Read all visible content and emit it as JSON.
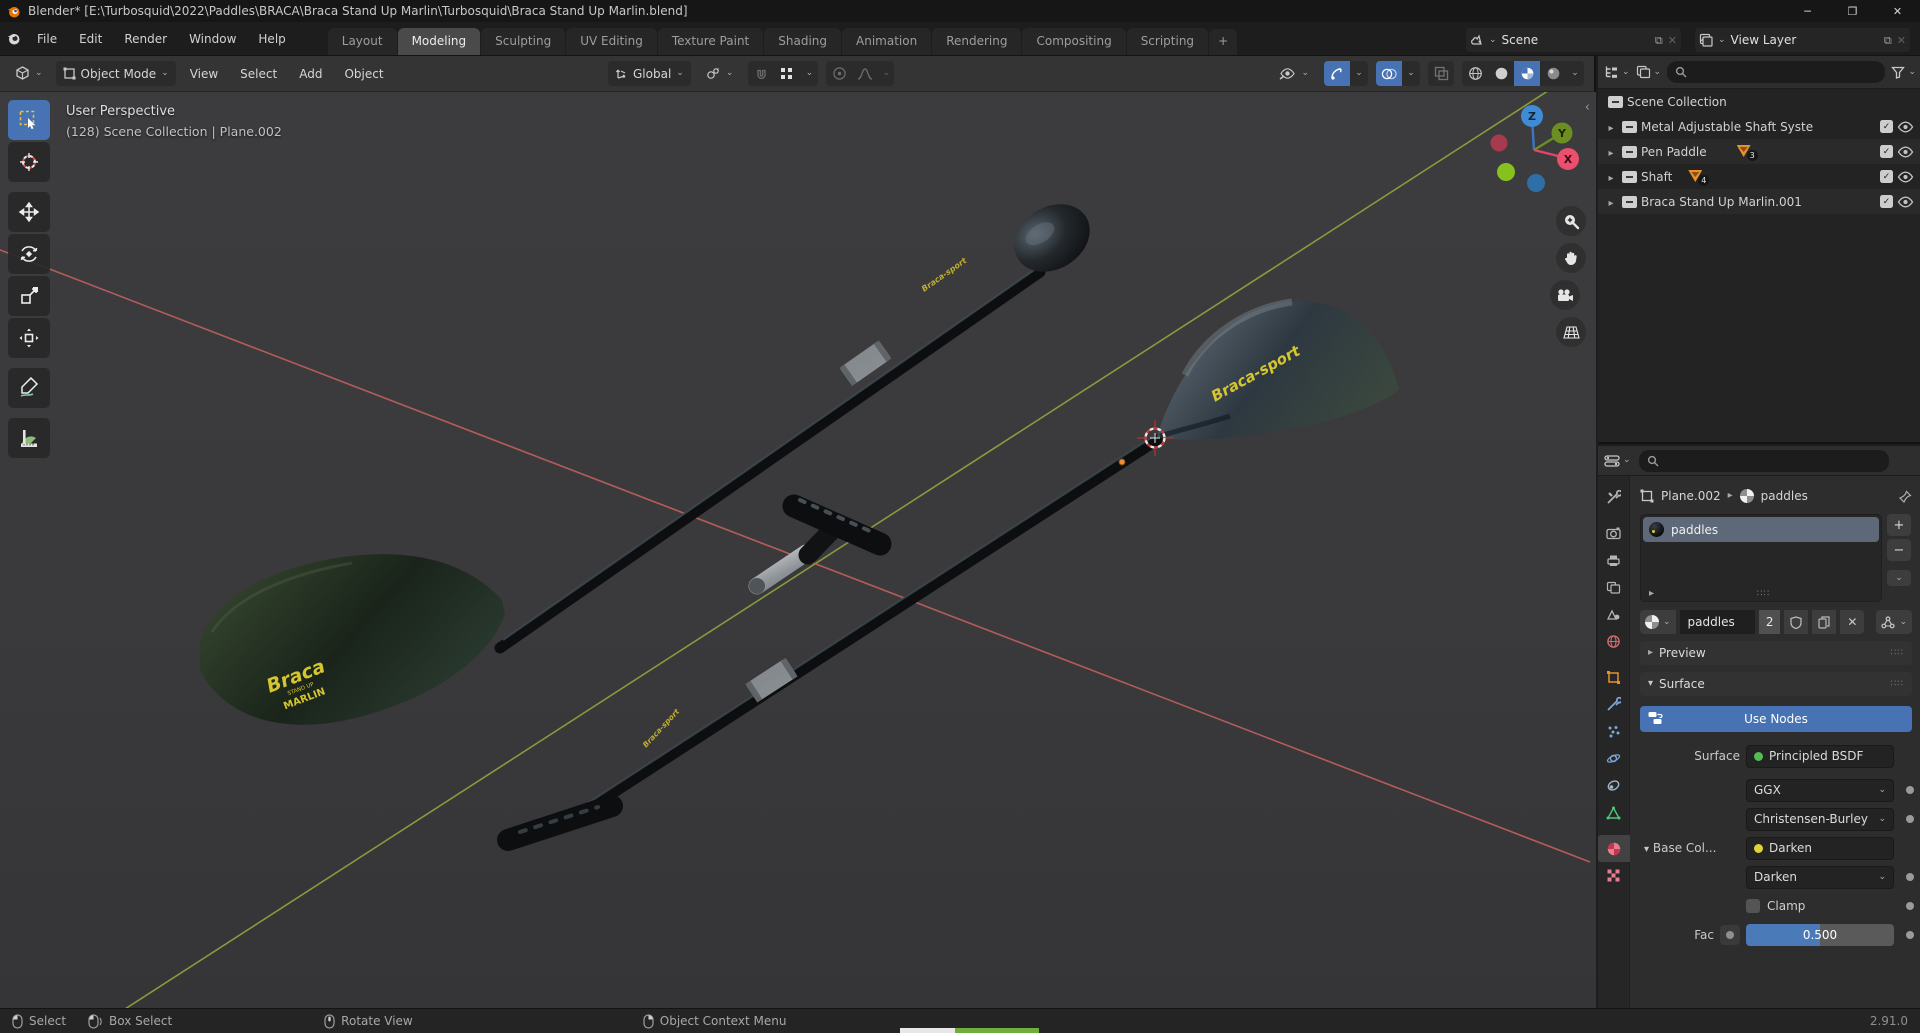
{
  "window": {
    "title": "Blender* [E:\\Turbosquid\\2022\\Paddles\\BRACA\\Braca Stand Up Marlin\\Turbosquid\\Braca Stand Up Marlin.blend]",
    "minimize": "─",
    "maximize": "❐",
    "close": "✕"
  },
  "menubar": {
    "menus": [
      "File",
      "Edit",
      "Render",
      "Window",
      "Help"
    ],
    "tabs": [
      "Layout",
      "Modeling",
      "Sculpting",
      "UV Editing",
      "Texture Paint",
      "Shading",
      "Animation",
      "Rendering",
      "Compositing",
      "Scripting"
    ],
    "active_tab": "Modeling",
    "add_tab": "+",
    "scene_selector": {
      "label": "Scene"
    },
    "view_layer_selector": {
      "label": "View Layer"
    }
  },
  "viewport_header": {
    "mode": "Object Mode",
    "menus": [
      "View",
      "Select",
      "Add",
      "Object"
    ],
    "orientation": "Global"
  },
  "viewport": {
    "overlay_line1": "User Perspective",
    "overlay_line2": "(128) Scene Collection | Plane.002",
    "axis": {
      "x": "X",
      "y": "Y",
      "z": "Z"
    },
    "logos": {
      "brand": "Braca-sport",
      "blade_brand": "Braca",
      "blade_line2": "STAND UP",
      "blade_line3": "MARLIN"
    }
  },
  "outliner": {
    "root": "Scene Collection",
    "items": [
      {
        "label": "Metal Adjustable Shaft System",
        "badge": ""
      },
      {
        "label": "Pen Paddle",
        "badge": "3"
      },
      {
        "label": "Shaft",
        "badge": "4"
      },
      {
        "label": "Braca Stand Up Marlin.001",
        "badge": ""
      }
    ]
  },
  "properties": {
    "breadcrumb": {
      "object": "Plane.002",
      "material": "paddles"
    },
    "slot_name": "paddles",
    "material_name": "paddles",
    "users_count": "2",
    "add_slot": "+",
    "remove_slot": "−",
    "preview_panel": "Preview",
    "surface_panel": "Surface",
    "use_nodes": "Use Nodes",
    "surface_label": "Surface",
    "surface_value": "Principled BSDF",
    "distribution": "GGX",
    "subsurface_method": "Christensen-Burley",
    "base_color_label": "Base Col...",
    "base_color_value": "Darken",
    "blend_mode": "Darken",
    "clamp_label": "Clamp",
    "fac_label": "Fac",
    "fac_value": "0.500"
  },
  "statusbar": {
    "select": "Select",
    "box_select": "Box Select",
    "rotate_view": "Rotate View",
    "context_menu": "Object Context Menu",
    "version": "2.91.0"
  },
  "colors": {
    "accent_blue": "#4772b3",
    "logo_yellow": "#d8ca35",
    "axis_x": "#ea4f6e",
    "axis_y": "#7fa32a",
    "axis_z": "#3f8cd6",
    "object_orange": "#e8902a",
    "bsdf_green": "#55bb55",
    "value_yellow": "#e0d23a"
  }
}
